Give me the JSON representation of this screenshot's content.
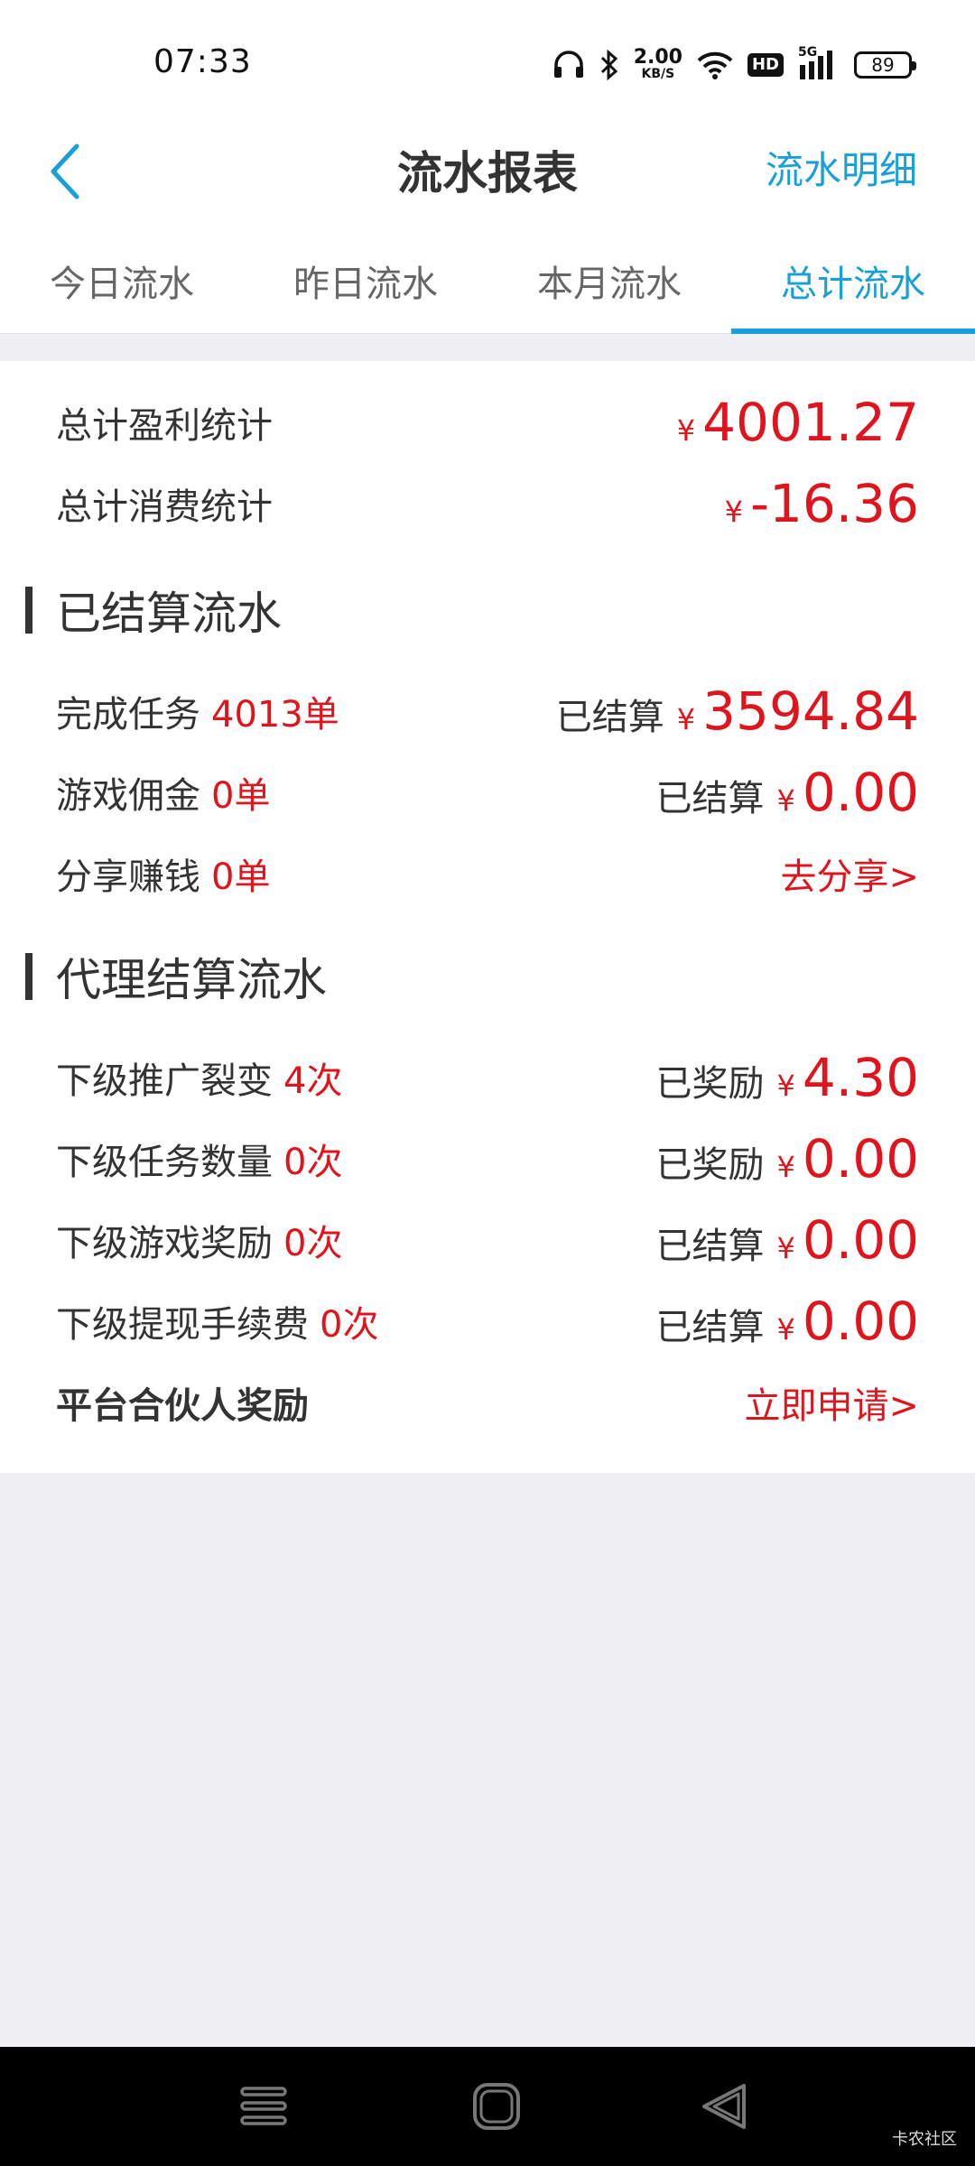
{
  "status_bar": {
    "time": "07:33",
    "net_speed_value": "2.00",
    "net_speed_unit": "KB/S",
    "hd": "HD",
    "signal": "5G",
    "battery": "89"
  },
  "header": {
    "title": "流水报表",
    "right_link": "流水明细"
  },
  "tabs": [
    {
      "label": "今日流水",
      "active": false
    },
    {
      "label": "昨日流水",
      "active": false
    },
    {
      "label": "本月流水",
      "active": false
    },
    {
      "label": "总计流水",
      "active": true
    }
  ],
  "summary": {
    "profit_label": "总计盈利统计",
    "profit_value": "4001.27",
    "consume_label": "总计消费统计",
    "consume_value": "-16.36",
    "currency": "¥"
  },
  "settled": {
    "title": "已结算流水",
    "rows": [
      {
        "label": "完成任务",
        "count": "4013单",
        "status": "已结算",
        "amount": "3594.84"
      },
      {
        "label": "游戏佣金",
        "count": "0单",
        "status": "已结算",
        "amount": "0.00"
      },
      {
        "label": "分享赚钱",
        "count": "0单",
        "link": "去分享>"
      }
    ]
  },
  "agent": {
    "title": "代理结算流水",
    "rows": [
      {
        "label": "下级推广裂变",
        "count": "4次",
        "status": "已奖励",
        "amount": "4.30"
      },
      {
        "label": "下级任务数量",
        "count": "0次",
        "status": "已奖励",
        "amount": "0.00"
      },
      {
        "label": "下级游戏奖励",
        "count": "0次",
        "status": "已结算",
        "amount": "0.00"
      },
      {
        "label": "下级提现手续费",
        "count": "0次",
        "status": "已结算",
        "amount": "0.00"
      },
      {
        "label": "平台合伙人奖励",
        "link": "立即申请>"
      }
    ]
  },
  "watermark": "卡农社区",
  "colors": {
    "accent": "#1a9fd9",
    "money_red": "#e0141c",
    "text": "#333333",
    "background": "#efeff4"
  }
}
